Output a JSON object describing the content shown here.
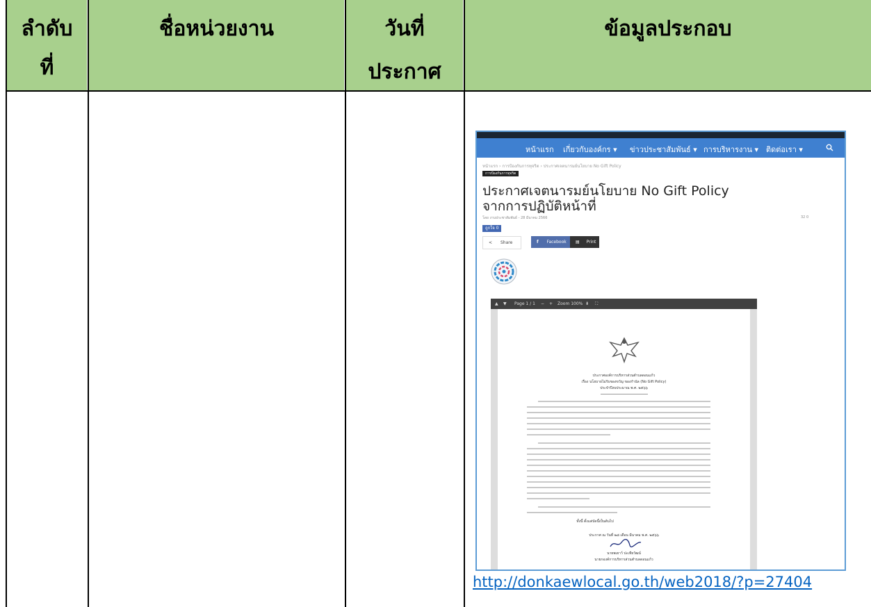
{
  "table": {
    "headers": {
      "col1_line1": "ลำดับ",
      "col1_line2": "ที่",
      "col2": "ชื่อหน่วยงาน",
      "col3_line1": "วันที่",
      "col3_line2": "ประกาศ",
      "col4": "ข้อมูลประกอบ"
    },
    "header_bg": "#a8d08d"
  },
  "website": {
    "nav": {
      "items": [
        "หน้าแรก",
        "เกี่ยวกับองค์กร ▾",
        "ข่าวประชาสัมพันธ์ ▾",
        "การบริหารงาน ▾",
        "ติดต่อเรา ▾"
      ],
      "search_icon": "search-icon",
      "color": "#3f80d0"
    },
    "breadcrumb": "หน้าแรก › การป้องกันการทุจริต › ประกาศเจตนารมย์นโยบาย No Gift Policy",
    "category": "การป้องกันการทุจริต",
    "title_line1": "ประกาศเจตนารมย์นโยบาย No Gift Policy",
    "title_line2": "จากการปฏิบัติหน้าที่",
    "meta": "โดย งานประชาสัมพันธ์ - 28 มีนาคม 2566",
    "stats": "32   0",
    "like_label": "ถูกใจ 0",
    "share_label": "Share",
    "facebook_label": "Facebook",
    "print_label": "Print",
    "viewer": {
      "page": "Page 1 / 1",
      "zoom": "Zoom 100%"
    },
    "document": {
      "line1": "ประกาศองค์การบริหารส่วนตำบลดอนแก้ว",
      "line2": "เรื่อง นโยบายไม่รับของขวัญ ของกำนัล (No Gift Policy)",
      "line3": "ประจำปีงบประมาณ พ.ศ. ๒๕๖๖",
      "closing": "ทั้งนี้ ตั้งแต่บัดนี้เป็นต้นไป",
      "date": "ประกาศ ณ วันที่ ๒๘ เดือน มีนาคม พ.ศ. ๒๕๖๖",
      "signer": "นายพเยาว์ ปะเทียวัฒน์",
      "position": "นายกองค์การบริหารส่วนตำบลดอนแก้ว"
    }
  },
  "link": "http://donkaewlocal.go.th/web2018/?p=27404"
}
